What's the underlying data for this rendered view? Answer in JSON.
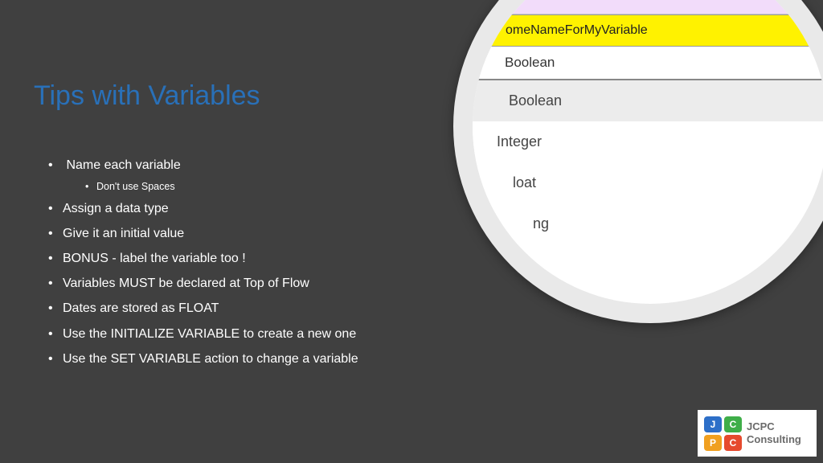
{
  "title": "Tips with Variables",
  "bullets": [
    "Name each variable",
    "Assign a data type",
    "Give it an initial value",
    "BONUS -  label the variable too !",
    "Variables MUST be declared at Top of Flow",
    "Dates are stored as FLOAT",
    "Use the INITIALIZE VARIABLE to create a new one",
    "Use the SET VARIABLE action to change  a variable"
  ],
  "sub_bullets": [
    "Don't use Spaces"
  ],
  "panel": {
    "variable_name": "omeNameForMyVariable",
    "selected_type": "Boolean",
    "options": [
      "Boolean",
      "Integer",
      "loat",
      "ng"
    ]
  },
  "logo": {
    "tiles": [
      "J",
      "C",
      "P",
      "C"
    ],
    "line1": "JCPC",
    "line2": "Consulting"
  }
}
